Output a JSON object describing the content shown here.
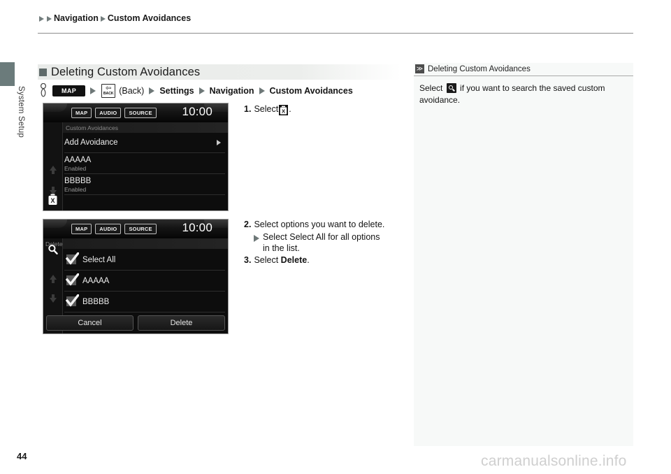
{
  "breadcrumb": {
    "level1": "Navigation",
    "level2": "Custom Avoidances"
  },
  "sidebar": {
    "label": "System Setup"
  },
  "section": {
    "title": "Deleting Custom Avoidances",
    "path": {
      "hand_icon": "hand-pointer-icon",
      "map_button": "MAP",
      "back_button_label": "BACK",
      "back_text": "(Back)",
      "item1": "Settings",
      "item2": "Navigation",
      "item3": "Custom Avoidances"
    }
  },
  "screenshot1": {
    "name": "custom-avoidances-list-screen",
    "hw_buttons": [
      "MAP",
      "AUDIO",
      "SOURCE"
    ],
    "clock": "10:00",
    "screen_title": "Custom Avoidances",
    "rows": [
      {
        "label": "Add Avoidance",
        "sub": "",
        "has_arrow": true
      },
      {
        "label": "AAAAA",
        "sub": "Enabled",
        "has_arrow": false
      },
      {
        "label": "BBBBB",
        "sub": "Enabled",
        "has_arrow": false
      }
    ],
    "trash_icon": "trash-delete-icon"
  },
  "screenshot2": {
    "name": "delete-selection-screen",
    "hw_buttons": [
      "MAP",
      "AUDIO",
      "SOURCE"
    ],
    "clock": "10:00",
    "screen_title": "Delete",
    "search_icon": "search-icon",
    "rows": [
      {
        "label": "Select All",
        "checked": true
      },
      {
        "label": "AAAAA",
        "checked": true
      },
      {
        "label": "BBBBB",
        "checked": true
      }
    ],
    "cancel_button": "Cancel",
    "delete_button": "Delete"
  },
  "steps": {
    "step1_num": "1.",
    "step1_text": "Select",
    "step1_icon": "trash-delete-icon",
    "step1_period": ".",
    "step2_num": "2.",
    "step2_text": "Select options you want to delete.",
    "step2_sub_pre": "Select",
    "step2_sub_bold": "Select All",
    "step2_sub_post": "for all options",
    "step2_sub_cont": "in the list.",
    "step3_num": "3.",
    "step3_pre": "Select",
    "step3_bold": "Delete",
    "step3_post": "."
  },
  "info": {
    "chevron": "≫",
    "title": "Deleting Custom Avoidances",
    "body_pre": "Select",
    "body_icon": "search-icon",
    "body_post": "if you want to search the saved custom avoidance."
  },
  "footer": {
    "page_number": "44",
    "watermark": "carmanualsonline.info"
  },
  "colors": {
    "accent_tab": "#6b7b7b",
    "heading_bg": "#e9ebe9",
    "panel_bg": "#f7f9f8"
  }
}
